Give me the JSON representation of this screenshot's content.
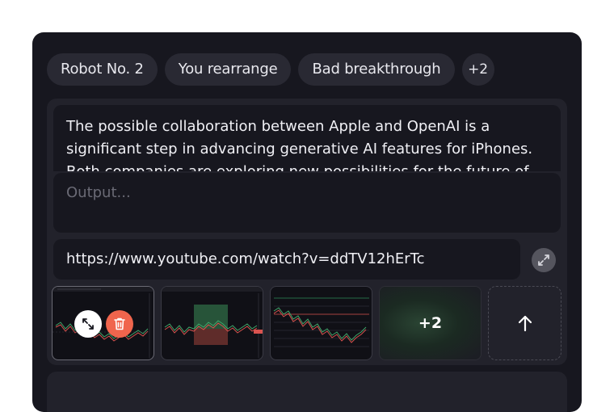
{
  "tags": [
    "Robot No. 2",
    "You rearrange",
    "Bad breakthrough"
  ],
  "tags_more": "+2",
  "prompt_text": "The possible collaboration between Apple and OpenAI is a significant step in advancing generative AI features for iPhones. Both companies are exploring new possibilities for the future of mobile technology.",
  "output_placeholder": "Output...",
  "url_value": "https://www.youtube.com/watch?v=ddTV12hErTc",
  "images_more": "+2",
  "icons": {
    "expand": "expand-icon",
    "trash": "trash-icon",
    "upload": "arrow-up-icon"
  },
  "colors": {
    "card": "#17171f",
    "panel": "#22222b",
    "chip": "#292933",
    "delete": "#f0654d"
  }
}
